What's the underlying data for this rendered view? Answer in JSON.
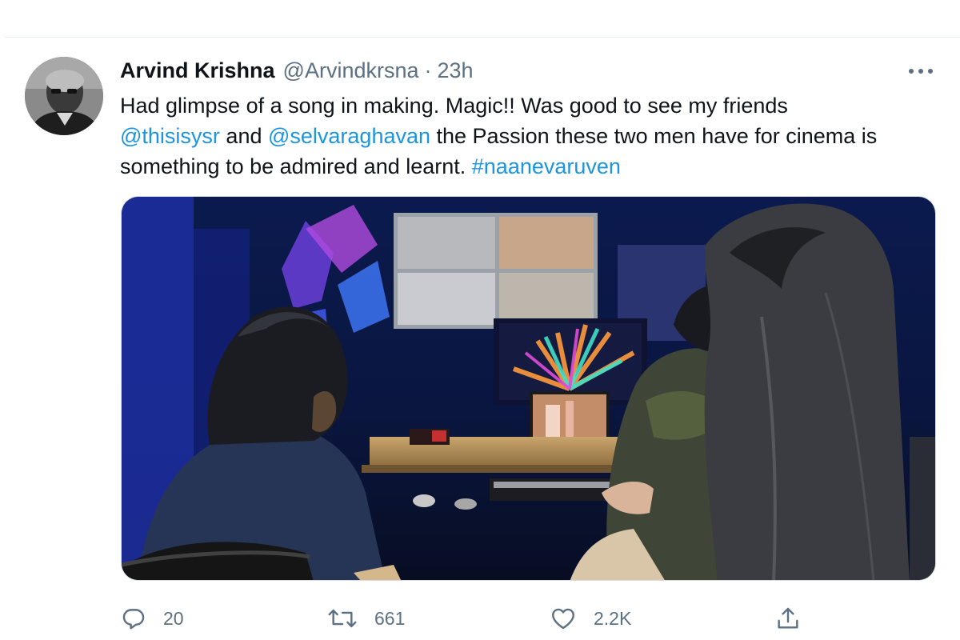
{
  "tweet": {
    "author_name": "Arvind Krishna",
    "handle": "@Arvindkrsna",
    "separator": "·",
    "time": "23h",
    "text": {
      "part1": "Had glimpse of a song in making. Magic!! Was good to see my friends",
      "mention1": "@thisisysr",
      "part2": " and ",
      "mention2": "@selvaraghavan",
      "part3": " the Passion these two men have for cinema is something to be admired and learnt. ",
      "hashtag": "#naanevaruven"
    },
    "media": {
      "icon": "photo-icon"
    },
    "actions": {
      "reply": {
        "icon": "reply-icon",
        "count": "20"
      },
      "retweet": {
        "icon": "retweet-icon",
        "count": "661"
      },
      "like": {
        "icon": "like-icon",
        "count": "2.2K"
      },
      "share": {
        "icon": "share-icon"
      }
    },
    "more_icon": "more-icon"
  },
  "colors": {
    "text": "#0f1419",
    "secondary": "#5b7083",
    "link": "#1b95e0",
    "divider": "#e6ecf0"
  }
}
